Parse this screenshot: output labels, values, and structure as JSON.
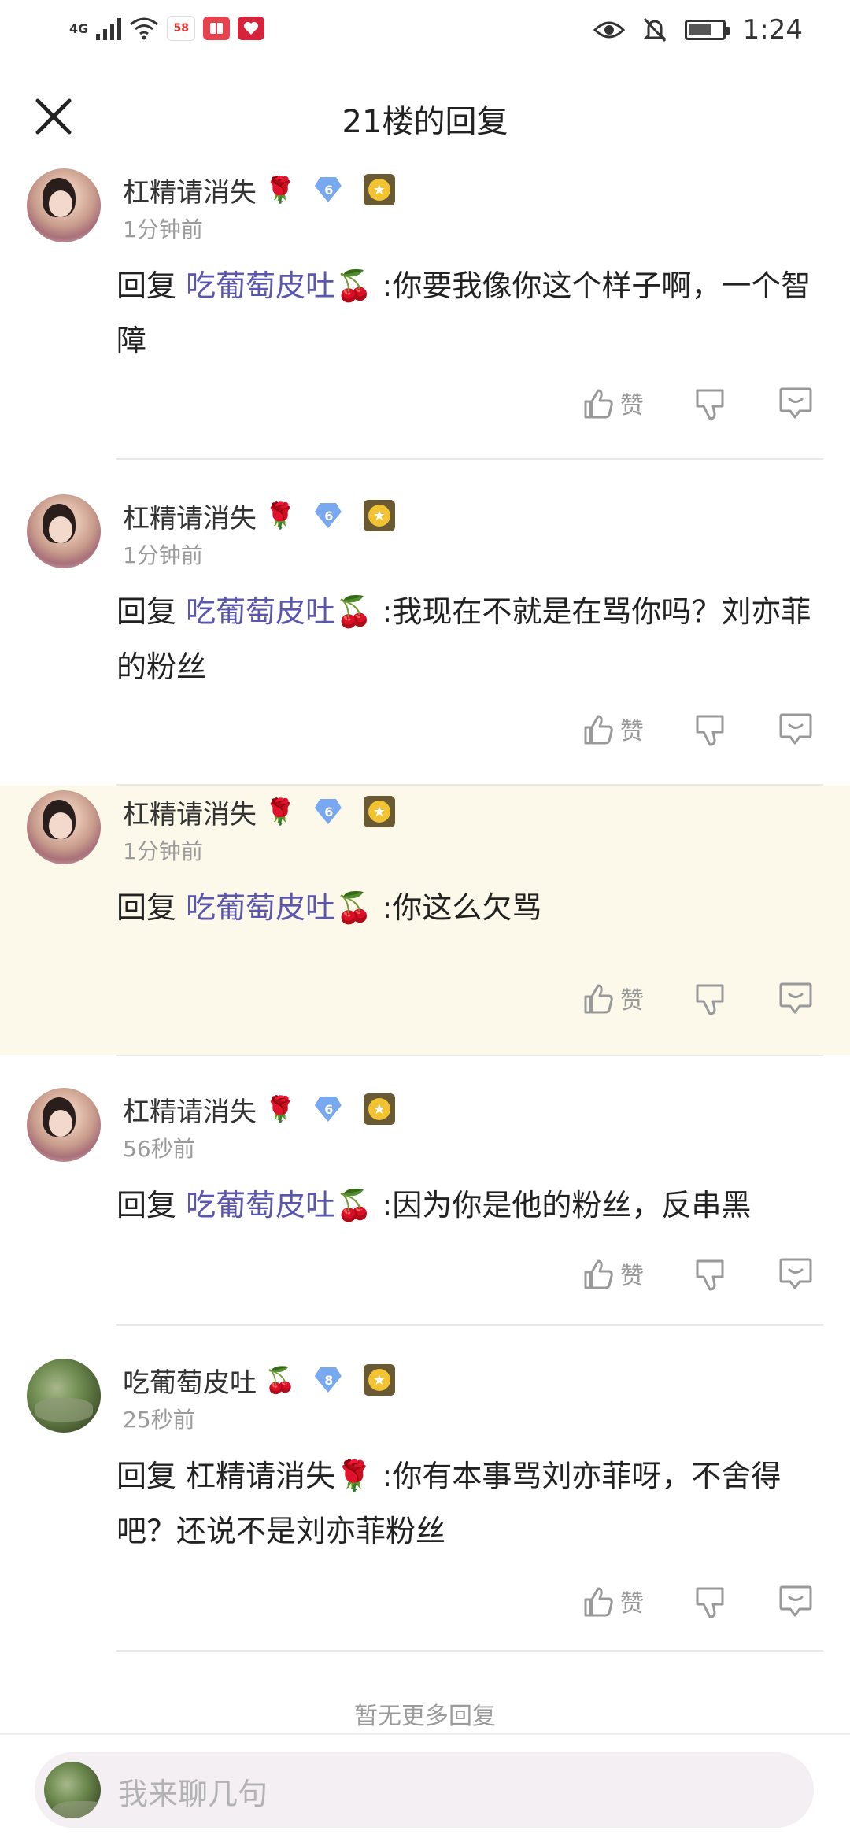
{
  "status_bar": {
    "network": "4G",
    "app_badge_1": "58",
    "time": "1:24",
    "icons": [
      "signal-icon",
      "wifi-icon",
      "app-58-icon",
      "app-red-book-icon",
      "app-heart-icon",
      "eye-icon",
      "bell-mute-icon",
      "battery-icon"
    ]
  },
  "header": {
    "title": "21楼的回复",
    "close_icon": "close-icon"
  },
  "comments": [
    {
      "username": "杠精请消失",
      "name_emoji": "🌹",
      "level": "6",
      "time": "1分钟前",
      "reply_prefix": "回复",
      "mention": "吃葡萄皮吐",
      "mention_emoji": "🍒",
      "text": " :你要我像你这个样子啊，一个智障",
      "like_label": "赞",
      "highlighted": false
    },
    {
      "username": "杠精请消失",
      "name_emoji": "🌹",
      "level": "6",
      "time": "1分钟前",
      "reply_prefix": "回复",
      "mention": "吃葡萄皮吐",
      "mention_emoji": "🍒",
      "text": " :我现在不就是在骂你吗？刘亦菲的粉丝",
      "like_label": "赞",
      "highlighted": false
    },
    {
      "username": "杠精请消失",
      "name_emoji": "🌹",
      "level": "6",
      "time": "1分钟前",
      "reply_prefix": "回复",
      "mention": "吃葡萄皮吐",
      "mention_emoji": "🍒",
      "text": " :你这么欠骂",
      "like_label": "赞",
      "highlighted": true
    },
    {
      "username": "杠精请消失",
      "name_emoji": "🌹",
      "level": "6",
      "time": "56秒前",
      "reply_prefix": "回复",
      "mention": "吃葡萄皮吐",
      "mention_emoji": "🍒",
      "text": " :因为你是他的粉丝，反串黑",
      "like_label": "赞",
      "highlighted": false
    },
    {
      "username": "吃葡萄皮吐",
      "name_emoji": "🍒",
      "level": "8",
      "time": "25秒前",
      "reply_prefix": "回复",
      "mention": "杠精请消失",
      "mention_emoji": "🌹",
      "text": ":你有本事骂刘亦菲呀，不舍得吧？还说不是刘亦菲粉丝",
      "like_label": "赞",
      "highlighted": false
    }
  ],
  "footer": {
    "no_more": "暂无更多回复",
    "input_placeholder": "我来聊几句"
  },
  "colors": {
    "mention": "#5b57b0",
    "highlight_bg": "#fdf9ea",
    "meta_gray": "#9a9a9a"
  }
}
